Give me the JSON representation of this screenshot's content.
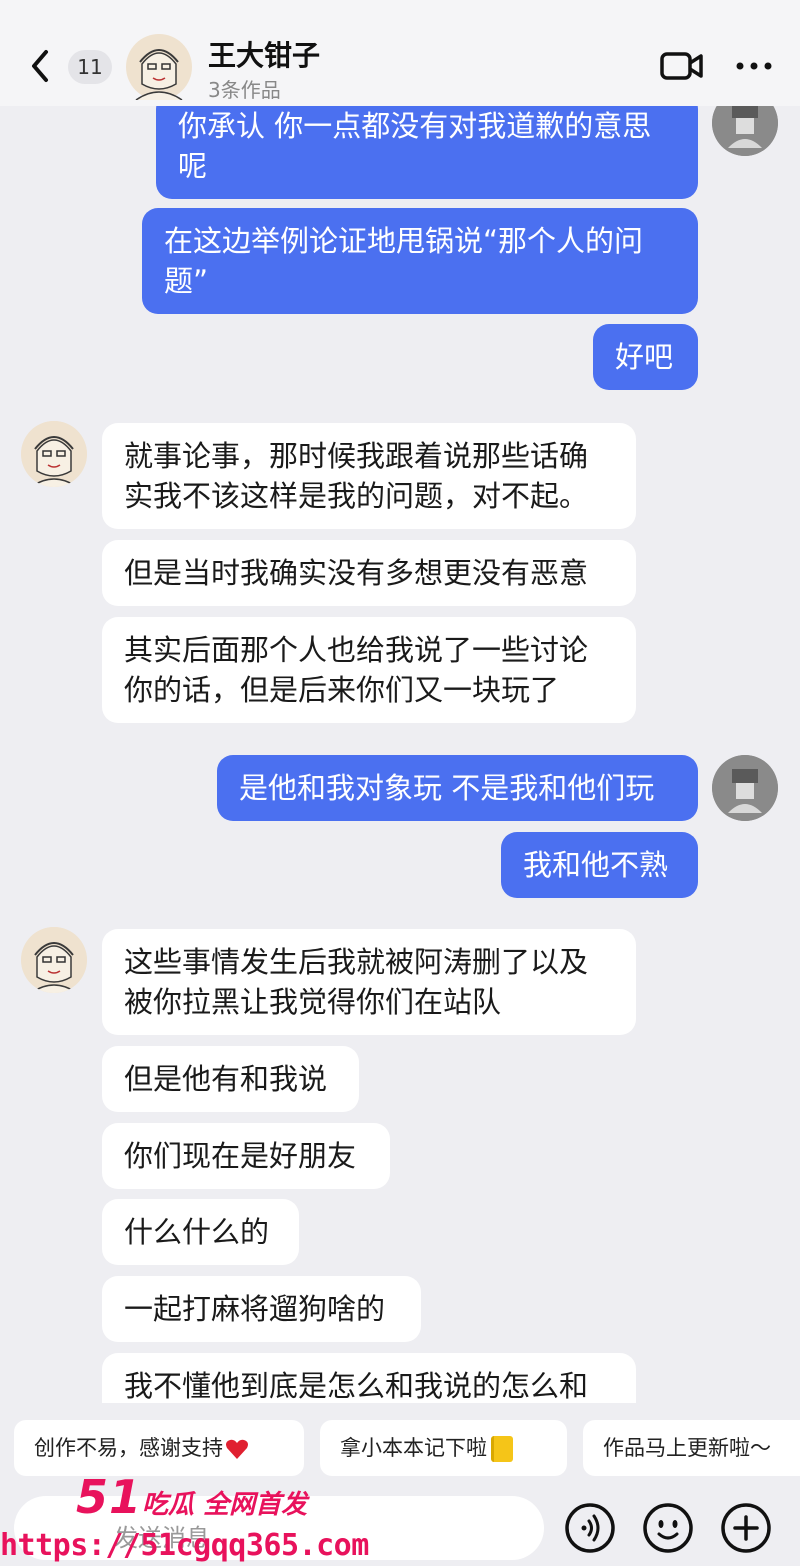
{
  "header": {
    "unread_count": "11",
    "contact_name": "王大钳子",
    "contact_subtitle": "3条作品"
  },
  "messages": [
    {
      "side": "sent",
      "text": "你承认 你一点都没有对我道歉的意思呢"
    },
    {
      "side": "sent",
      "text": "在这边举例论证地甩锅说“那个人的问题”"
    },
    {
      "side": "sent",
      "text": "好吧"
    },
    {
      "side": "received",
      "text": "就事论事，那时候我跟着说那些话确实我不该这样是我的问题，对不起。"
    },
    {
      "side": "received",
      "text": "但是当时我确实没有多想更没有恶意"
    },
    {
      "side": "received",
      "text": "其实后面那个人也给我说了一些讨论你的话，但是后来你们又一块玩了"
    },
    {
      "side": "sent",
      "text": "是他和我对象玩 不是我和他们玩"
    },
    {
      "side": "sent",
      "text": "我和他不熟"
    },
    {
      "side": "received",
      "text": "这些事情发生后我就被阿涛删了以及被你拉黑让我觉得你们在站队"
    },
    {
      "side": "received",
      "text": "但是他有和我说"
    },
    {
      "side": "received",
      "text": "你们现在是好朋友"
    },
    {
      "side": "received",
      "text": "什么什么的"
    },
    {
      "side": "received",
      "text": "一起打麻将遛狗啥的"
    },
    {
      "side": "received",
      "text": "我不懂他到底是怎么和我说的怎么和"
    }
  ],
  "quick_replies": [
    "创作不易，感谢支持",
    "拿小本本记下啦",
    "作品马上更新啦～"
  ],
  "input": {
    "placeholder": "发送消息"
  },
  "watermark": {
    "logo_big": "51",
    "logo_text": "吃瓜 全网首发",
    "url": "https://51cgqq365.com"
  },
  "colors": {
    "sent_bubble": "#4b70f0",
    "received_bubble": "#ffffff",
    "background": "#eeeef2",
    "watermark": "#e8125c"
  },
  "icons": [
    "back-chevron-icon",
    "video-call-icon",
    "more-dots-icon",
    "voice-icon",
    "emoji-icon",
    "plus-icon"
  ]
}
